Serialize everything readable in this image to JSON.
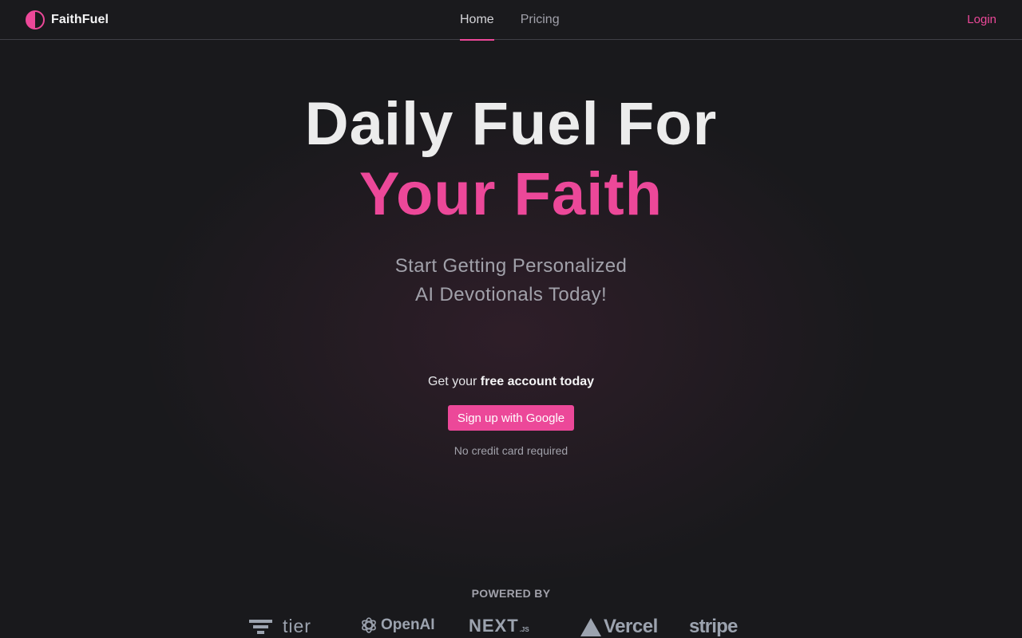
{
  "header": {
    "brand": "FaithFuel",
    "nav": [
      {
        "label": "Home",
        "active": true
      },
      {
        "label": "Pricing",
        "active": false
      }
    ],
    "login_label": "Login"
  },
  "hero": {
    "title_line1": "Daily Fuel For",
    "title_line2": "Your Faith",
    "subtitle_line1": "Start Getting Personalized",
    "subtitle_line2": "AI Devotionals Today!"
  },
  "cta": {
    "prefix": "Get your ",
    "emphasis": "free account today",
    "button_label": "Sign up with Google",
    "note": "No credit card required"
  },
  "powered_by": {
    "heading": "POWERED BY",
    "logos": [
      {
        "name": "tier",
        "text": "tier"
      },
      {
        "name": "openai",
        "text": "OpenAI"
      },
      {
        "name": "nextjs",
        "text": "NEXT",
        "suffix": ".JS"
      },
      {
        "name": "vercel",
        "text": "Vercel"
      },
      {
        "name": "stripe",
        "text": "stripe"
      }
    ]
  },
  "colors": {
    "accent": "#ec4899",
    "background": "#19191c",
    "muted": "#a1a1aa"
  }
}
